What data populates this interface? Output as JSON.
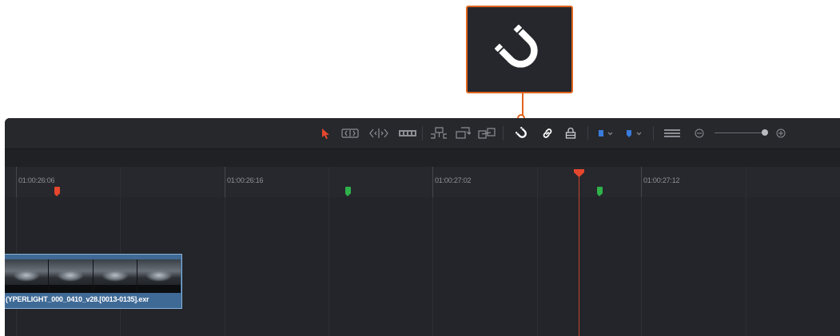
{
  "callout": {
    "icon": "magnet-icon",
    "border_color": "#e0641e"
  },
  "toolbar": {
    "icons": [
      "selection-arrow-icon",
      "trim-edit-icon",
      "dynamic-trim-icon",
      "blade-edit-icon",
      "insert-clip-icon",
      "overwrite-clip-icon",
      "replace-clip-icon",
      "snapping-magnet-icon",
      "linked-selection-icon",
      "position-lock-icon",
      "flag-icon",
      "marker-icon",
      "zoom-full-extent-icon",
      "zoom-out-icon",
      "zoom-in-icon"
    ],
    "accent_red": "#e5462e",
    "flag_blue": "#3a7bdc"
  },
  "ruler": {
    "timecodes": [
      "01:00:26:06",
      "01:00:26:16",
      "01:00:27:02",
      "01:00:27:12"
    ],
    "marker_colors": {
      "red": "#e5462e",
      "green": "#2fb24a"
    }
  },
  "clip": {
    "name": "(YPERLIGHT_000_0410_v28.[0013-0135].exr",
    "color": "#3f6a96"
  },
  "playhead": {
    "color": "#e5462e"
  }
}
